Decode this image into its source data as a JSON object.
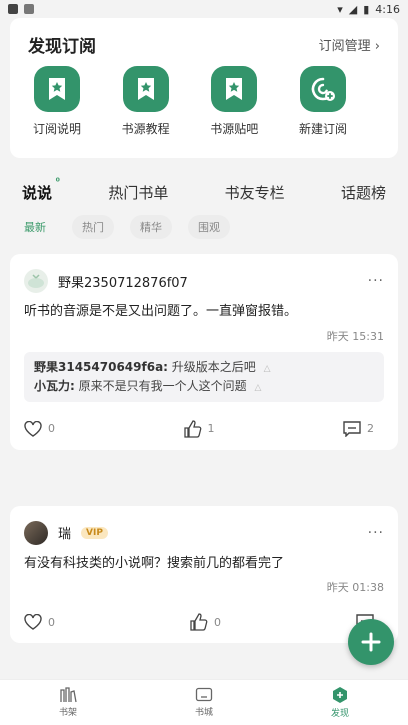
{
  "status_bar": {
    "time": "4:16"
  },
  "discover": {
    "title": "发现订阅",
    "manage": "订阅管理 ›",
    "tiles": [
      {
        "label": "订阅说明",
        "icon": "bookmark-star-icon"
      },
      {
        "label": "书源教程",
        "icon": "bookmark-star-icon"
      },
      {
        "label": "书源贴吧",
        "icon": "bookmark-star-icon"
      },
      {
        "label": "新建订阅",
        "icon": "add-subscription-icon"
      }
    ]
  },
  "tabs": [
    {
      "label": "说说",
      "active": true
    },
    {
      "label": "热门书单"
    },
    {
      "label": "书友专栏"
    },
    {
      "label": "话题榜"
    }
  ],
  "filters": [
    {
      "label": "最新",
      "active": true
    },
    {
      "label": "热门"
    },
    {
      "label": "精华"
    },
    {
      "label": "围观"
    }
  ],
  "posts": [
    {
      "author": "野果2350712876f07",
      "text": "听书的音源是不是又出问题了。一直弹窗报错。",
      "time": "昨天 15:31",
      "replies": [
        {
          "user": "野果3145470649f6a:",
          "text": "升级版本之后吧"
        },
        {
          "user": "小瓦力:",
          "text": "原来不是只有我一个人这个问题"
        }
      ],
      "likes": "0",
      "thumbs": "1",
      "comments": "2"
    },
    {
      "author": "瑞",
      "badge": "VIP",
      "text": "有没有科技类的小说啊？搜索前几的都看完了",
      "time": "昨天 01:38",
      "likes": "0",
      "thumbs": "0"
    }
  ],
  "bottom_nav": [
    {
      "label": "书架"
    },
    {
      "label": "书城"
    },
    {
      "label": "发现",
      "active": true
    }
  ],
  "colors": {
    "accent": "#33946b",
    "vip": "#c88a1b"
  }
}
